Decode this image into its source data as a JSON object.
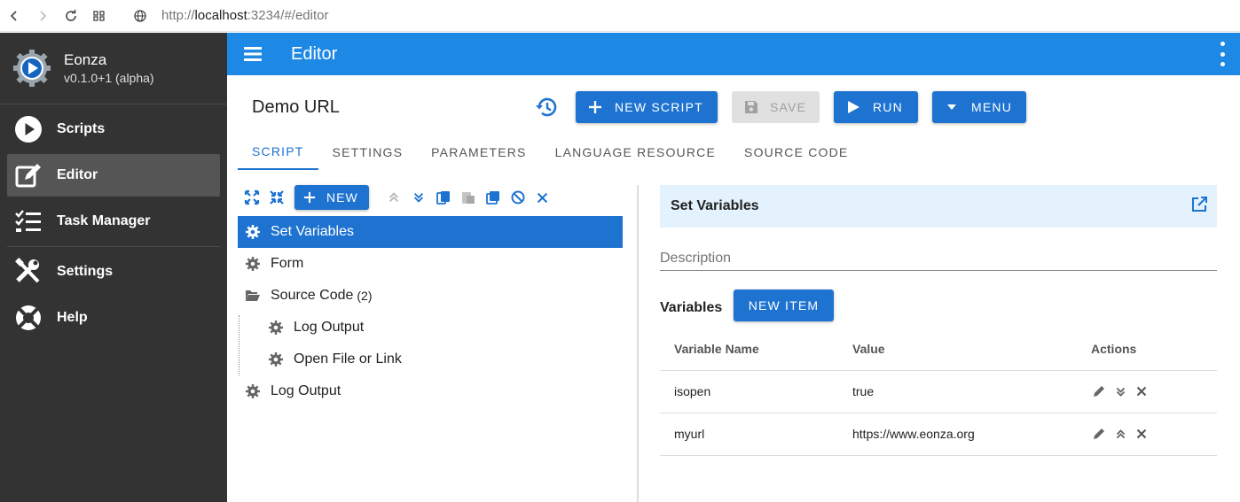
{
  "browser": {
    "url_prefix": "http://",
    "url_host": "localhost",
    "url_rest": ":3234/#/editor"
  },
  "sidebar": {
    "app_name": "Eonza",
    "version": "v0.1.0+1 (alpha)",
    "items": [
      {
        "label": "Scripts",
        "icon": "play-circle-icon"
      },
      {
        "label": "Editor",
        "icon": "edit-icon",
        "active": true
      },
      {
        "label": "Task Manager",
        "icon": "checklist-icon"
      },
      {
        "label": "Settings",
        "icon": "tools-icon"
      },
      {
        "label": "Help",
        "icon": "lifebuoy-icon"
      }
    ]
  },
  "appbar": {
    "title": "Editor"
  },
  "toolbar": {
    "doc_title": "Demo URL",
    "new_script": "NEW SCRIPT",
    "save": "SAVE",
    "run": "RUN",
    "menu": "MENU"
  },
  "tabs": [
    "SCRIPT",
    "SETTINGS",
    "PARAMETERS",
    "LANGUAGE RESOURCE",
    "SOURCE CODE"
  ],
  "tree_toolbar": {
    "new_label": "NEW"
  },
  "tree": {
    "nodes": [
      {
        "label": "Set Variables"
      },
      {
        "label": "Form"
      },
      {
        "label": "Source Code",
        "count": "(2)"
      },
      {
        "label": "Log Output"
      },
      {
        "label": "Open File or Link"
      },
      {
        "label": "Log Output"
      }
    ]
  },
  "panel": {
    "title": "Set Variables",
    "description_placeholder": "Description",
    "variables_label": "Variables",
    "new_item": "NEW ITEM",
    "columns": [
      "Variable Name",
      "Value",
      "Actions"
    ],
    "rows": [
      {
        "name": "isopen",
        "value": "true"
      },
      {
        "name": "myurl",
        "value": "https://www.eonza.org"
      }
    ]
  },
  "colors": {
    "primary": "#1e88e5",
    "button": "#1e73d1",
    "sidebar": "#333333",
    "panel_header": "#e3f2fd"
  }
}
